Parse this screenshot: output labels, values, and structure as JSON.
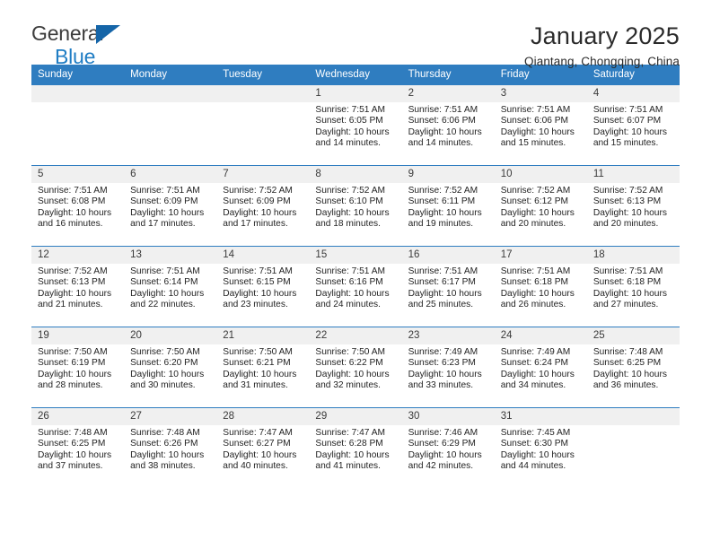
{
  "brand": {
    "name_line1": "General",
    "name_line2": "Blue",
    "accent_color": "#1f7dc4",
    "triangle_color": "#1565a8"
  },
  "header": {
    "title": "January 2025",
    "location": "Qiantang, Chongqing, China"
  },
  "calendar": {
    "header_bg": "#2f7dc0",
    "daynum_bg": "#f0f0f0",
    "weekday_headers": [
      "Sunday",
      "Monday",
      "Tuesday",
      "Wednesday",
      "Thursday",
      "Friday",
      "Saturday"
    ],
    "weeks": [
      [
        {
          "day": "",
          "empty": true,
          "sunrise": "",
          "sunset": "",
          "daylight_line1": "",
          "daylight_line2": ""
        },
        {
          "day": "",
          "empty": true,
          "sunrise": "",
          "sunset": "",
          "daylight_line1": "",
          "daylight_line2": ""
        },
        {
          "day": "",
          "empty": true,
          "sunrise": "",
          "sunset": "",
          "daylight_line1": "",
          "daylight_line2": ""
        },
        {
          "day": "1",
          "empty": false,
          "sunrise": "Sunrise: 7:51 AM",
          "sunset": "Sunset: 6:05 PM",
          "daylight_line1": "Daylight: 10 hours",
          "daylight_line2": "and 14 minutes."
        },
        {
          "day": "2",
          "empty": false,
          "sunrise": "Sunrise: 7:51 AM",
          "sunset": "Sunset: 6:06 PM",
          "daylight_line1": "Daylight: 10 hours",
          "daylight_line2": "and 14 minutes."
        },
        {
          "day": "3",
          "empty": false,
          "sunrise": "Sunrise: 7:51 AM",
          "sunset": "Sunset: 6:06 PM",
          "daylight_line1": "Daylight: 10 hours",
          "daylight_line2": "and 15 minutes."
        },
        {
          "day": "4",
          "empty": false,
          "sunrise": "Sunrise: 7:51 AM",
          "sunset": "Sunset: 6:07 PM",
          "daylight_line1": "Daylight: 10 hours",
          "daylight_line2": "and 15 minutes."
        }
      ],
      [
        {
          "day": "5",
          "empty": false,
          "sunrise": "Sunrise: 7:51 AM",
          "sunset": "Sunset: 6:08 PM",
          "daylight_line1": "Daylight: 10 hours",
          "daylight_line2": "and 16 minutes."
        },
        {
          "day": "6",
          "empty": false,
          "sunrise": "Sunrise: 7:51 AM",
          "sunset": "Sunset: 6:09 PM",
          "daylight_line1": "Daylight: 10 hours",
          "daylight_line2": "and 17 minutes."
        },
        {
          "day": "7",
          "empty": false,
          "sunrise": "Sunrise: 7:52 AM",
          "sunset": "Sunset: 6:09 PM",
          "daylight_line1": "Daylight: 10 hours",
          "daylight_line2": "and 17 minutes."
        },
        {
          "day": "8",
          "empty": false,
          "sunrise": "Sunrise: 7:52 AM",
          "sunset": "Sunset: 6:10 PM",
          "daylight_line1": "Daylight: 10 hours",
          "daylight_line2": "and 18 minutes."
        },
        {
          "day": "9",
          "empty": false,
          "sunrise": "Sunrise: 7:52 AM",
          "sunset": "Sunset: 6:11 PM",
          "daylight_line1": "Daylight: 10 hours",
          "daylight_line2": "and 19 minutes."
        },
        {
          "day": "10",
          "empty": false,
          "sunrise": "Sunrise: 7:52 AM",
          "sunset": "Sunset: 6:12 PM",
          "daylight_line1": "Daylight: 10 hours",
          "daylight_line2": "and 20 minutes."
        },
        {
          "day": "11",
          "empty": false,
          "sunrise": "Sunrise: 7:52 AM",
          "sunset": "Sunset: 6:13 PM",
          "daylight_line1": "Daylight: 10 hours",
          "daylight_line2": "and 20 minutes."
        }
      ],
      [
        {
          "day": "12",
          "empty": false,
          "sunrise": "Sunrise: 7:52 AM",
          "sunset": "Sunset: 6:13 PM",
          "daylight_line1": "Daylight: 10 hours",
          "daylight_line2": "and 21 minutes."
        },
        {
          "day": "13",
          "empty": false,
          "sunrise": "Sunrise: 7:51 AM",
          "sunset": "Sunset: 6:14 PM",
          "daylight_line1": "Daylight: 10 hours",
          "daylight_line2": "and 22 minutes."
        },
        {
          "day": "14",
          "empty": false,
          "sunrise": "Sunrise: 7:51 AM",
          "sunset": "Sunset: 6:15 PM",
          "daylight_line1": "Daylight: 10 hours",
          "daylight_line2": "and 23 minutes."
        },
        {
          "day": "15",
          "empty": false,
          "sunrise": "Sunrise: 7:51 AM",
          "sunset": "Sunset: 6:16 PM",
          "daylight_line1": "Daylight: 10 hours",
          "daylight_line2": "and 24 minutes."
        },
        {
          "day": "16",
          "empty": false,
          "sunrise": "Sunrise: 7:51 AM",
          "sunset": "Sunset: 6:17 PM",
          "daylight_line1": "Daylight: 10 hours",
          "daylight_line2": "and 25 minutes."
        },
        {
          "day": "17",
          "empty": false,
          "sunrise": "Sunrise: 7:51 AM",
          "sunset": "Sunset: 6:18 PM",
          "daylight_line1": "Daylight: 10 hours",
          "daylight_line2": "and 26 minutes."
        },
        {
          "day": "18",
          "empty": false,
          "sunrise": "Sunrise: 7:51 AM",
          "sunset": "Sunset: 6:18 PM",
          "daylight_line1": "Daylight: 10 hours",
          "daylight_line2": "and 27 minutes."
        }
      ],
      [
        {
          "day": "19",
          "empty": false,
          "sunrise": "Sunrise: 7:50 AM",
          "sunset": "Sunset: 6:19 PM",
          "daylight_line1": "Daylight: 10 hours",
          "daylight_line2": "and 28 minutes."
        },
        {
          "day": "20",
          "empty": false,
          "sunrise": "Sunrise: 7:50 AM",
          "sunset": "Sunset: 6:20 PM",
          "daylight_line1": "Daylight: 10 hours",
          "daylight_line2": "and 30 minutes."
        },
        {
          "day": "21",
          "empty": false,
          "sunrise": "Sunrise: 7:50 AM",
          "sunset": "Sunset: 6:21 PM",
          "daylight_line1": "Daylight: 10 hours",
          "daylight_line2": "and 31 minutes."
        },
        {
          "day": "22",
          "empty": false,
          "sunrise": "Sunrise: 7:50 AM",
          "sunset": "Sunset: 6:22 PM",
          "daylight_line1": "Daylight: 10 hours",
          "daylight_line2": "and 32 minutes."
        },
        {
          "day": "23",
          "empty": false,
          "sunrise": "Sunrise: 7:49 AM",
          "sunset": "Sunset: 6:23 PM",
          "daylight_line1": "Daylight: 10 hours",
          "daylight_line2": "and 33 minutes."
        },
        {
          "day": "24",
          "empty": false,
          "sunrise": "Sunrise: 7:49 AM",
          "sunset": "Sunset: 6:24 PM",
          "daylight_line1": "Daylight: 10 hours",
          "daylight_line2": "and 34 minutes."
        },
        {
          "day": "25",
          "empty": false,
          "sunrise": "Sunrise: 7:48 AM",
          "sunset": "Sunset: 6:25 PM",
          "daylight_line1": "Daylight: 10 hours",
          "daylight_line2": "and 36 minutes."
        }
      ],
      [
        {
          "day": "26",
          "empty": false,
          "sunrise": "Sunrise: 7:48 AM",
          "sunset": "Sunset: 6:25 PM",
          "daylight_line1": "Daylight: 10 hours",
          "daylight_line2": "and 37 minutes."
        },
        {
          "day": "27",
          "empty": false,
          "sunrise": "Sunrise: 7:48 AM",
          "sunset": "Sunset: 6:26 PM",
          "daylight_line1": "Daylight: 10 hours",
          "daylight_line2": "and 38 minutes."
        },
        {
          "day": "28",
          "empty": false,
          "sunrise": "Sunrise: 7:47 AM",
          "sunset": "Sunset: 6:27 PM",
          "daylight_line1": "Daylight: 10 hours",
          "daylight_line2": "and 40 minutes."
        },
        {
          "day": "29",
          "empty": false,
          "sunrise": "Sunrise: 7:47 AM",
          "sunset": "Sunset: 6:28 PM",
          "daylight_line1": "Daylight: 10 hours",
          "daylight_line2": "and 41 minutes."
        },
        {
          "day": "30",
          "empty": false,
          "sunrise": "Sunrise: 7:46 AM",
          "sunset": "Sunset: 6:29 PM",
          "daylight_line1": "Daylight: 10 hours",
          "daylight_line2": "and 42 minutes."
        },
        {
          "day": "31",
          "empty": false,
          "sunrise": "Sunrise: 7:45 AM",
          "sunset": "Sunset: 6:30 PM",
          "daylight_line1": "Daylight: 10 hours",
          "daylight_line2": "and 44 minutes."
        },
        {
          "day": "",
          "empty": true,
          "sunrise": "",
          "sunset": "",
          "daylight_line1": "",
          "daylight_line2": ""
        }
      ]
    ]
  }
}
